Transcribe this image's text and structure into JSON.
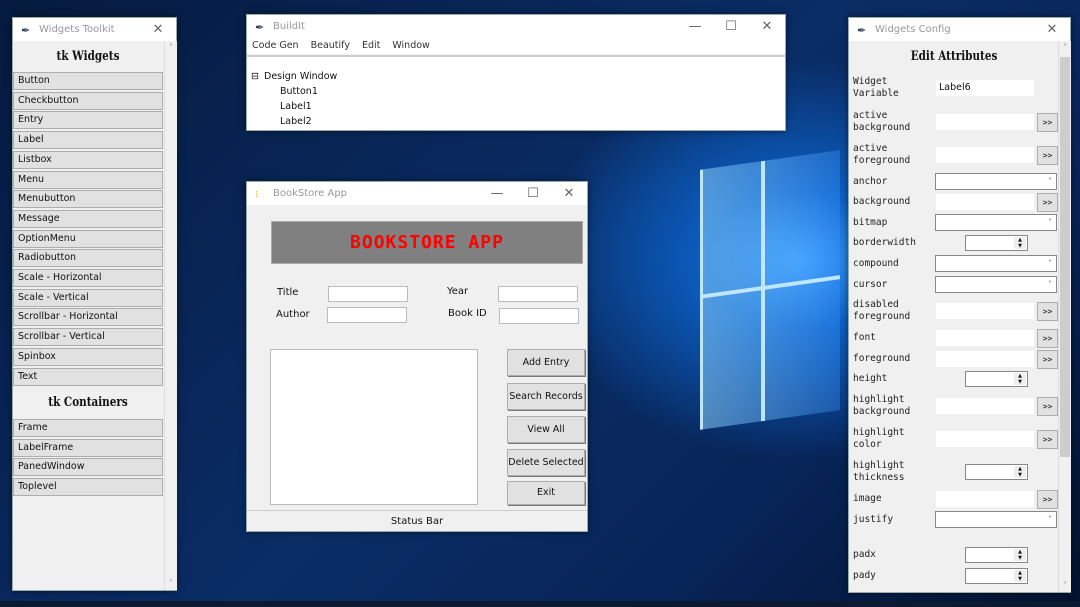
{
  "toolkit": {
    "title": "Widgets Toolkit",
    "widgets_header": "tk Widgets",
    "widgets": [
      "Button",
      "Checkbutton",
      "Entry",
      "Label",
      "Listbox",
      "Menu",
      "Menubutton",
      "Message",
      "OptionMenu",
      "Radiobutton",
      "Scale - Horizontal",
      "Scale - Vertical",
      "Scrollbar - Horizontal",
      "Scrollbar - Vertical",
      "Spinbox",
      "Text"
    ],
    "containers_header": "tk Containers",
    "containers": [
      "Frame",
      "LabelFrame",
      "PanedWindow",
      "Toplevel"
    ]
  },
  "buildit": {
    "title": "BuildIt",
    "menu": [
      "Code Gen",
      "Beautify",
      "Edit",
      "Window"
    ],
    "tree": {
      "root": "Design Window",
      "children": [
        "Button1",
        "Label1",
        "Label2"
      ]
    }
  },
  "bookstore": {
    "title": "BookStore App",
    "banner": "BOOKSTORE APP",
    "banner_color": "#ff0000",
    "fields": {
      "title": "Title",
      "author": "Author",
      "year": "Year",
      "book_id": "Book ID"
    },
    "buttons": [
      "Add Entry",
      "Search Records",
      "View All",
      "Delete Selected",
      "Exit"
    ],
    "status": "Status Bar"
  },
  "config": {
    "title": "Widgets Config",
    "header": "Edit Attributes",
    "rows": [
      {
        "label": "Widget\nVariable",
        "type": "text",
        "value": "Label6"
      },
      {
        "label": "active\nbackground",
        "type": "color"
      },
      {
        "label": "active\nforeground",
        "type": "color"
      },
      {
        "label": "anchor",
        "type": "combo"
      },
      {
        "label": "background",
        "type": "color"
      },
      {
        "label": "bitmap",
        "type": "combo"
      },
      {
        "label": "borderwidth",
        "type": "spin"
      },
      {
        "label": "compound",
        "type": "combo"
      },
      {
        "label": "cursor",
        "type": "combo"
      },
      {
        "label": "disabled\nforeground",
        "type": "color"
      },
      {
        "label": "font",
        "type": "color"
      },
      {
        "label": "foreground",
        "type": "color"
      },
      {
        "label": "height",
        "type": "spin"
      },
      {
        "label": "highlight\nbackground",
        "type": "color"
      },
      {
        "label": "highlight\ncolor",
        "type": "color"
      },
      {
        "label": "highlight\nthickness",
        "type": "spin"
      },
      {
        "label": "image",
        "type": "color"
      },
      {
        "label": "justify",
        "type": "combo"
      },
      {
        "label": "padx",
        "type": "spin"
      },
      {
        "label": "pady",
        "type": "spin"
      }
    ],
    "picker_label": ">>"
  }
}
